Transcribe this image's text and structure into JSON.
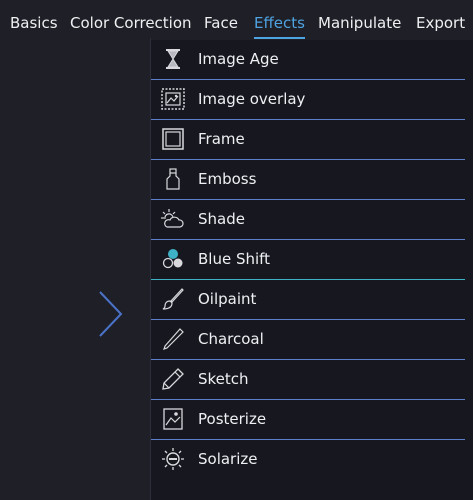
{
  "tabs": [
    {
      "label": "Basics",
      "active": false
    },
    {
      "label": "Color Correction",
      "active": false
    },
    {
      "label": "Face",
      "active": false
    },
    {
      "label": "Effects",
      "active": true
    },
    {
      "label": "Manipulate",
      "active": false
    },
    {
      "label": "Export",
      "active": false
    }
  ],
  "menu": {
    "items": [
      {
        "label": "Image Age",
        "icon": "hourglass-icon"
      },
      {
        "label": "Image overlay",
        "icon": "image-overlay-icon"
      },
      {
        "label": "Frame",
        "icon": "frame-icon"
      },
      {
        "label": "Emboss",
        "icon": "bottle-icon"
      },
      {
        "label": "Shade",
        "icon": "sun-cloud-icon"
      },
      {
        "label": "Blue Shift",
        "icon": "color-dots-icon"
      },
      {
        "label": "Oilpaint",
        "icon": "brush-icon"
      },
      {
        "label": "Charcoal",
        "icon": "charcoal-stick-icon"
      },
      {
        "label": "Sketch",
        "icon": "pencil-icon"
      },
      {
        "label": "Posterize",
        "icon": "poster-icon"
      },
      {
        "label": "Solarize",
        "icon": "solar-icon"
      }
    ]
  },
  "colors": {
    "accent": "#4fa3e0",
    "divider": "#5b7fc9",
    "chevron": "#4a73c8"
  }
}
